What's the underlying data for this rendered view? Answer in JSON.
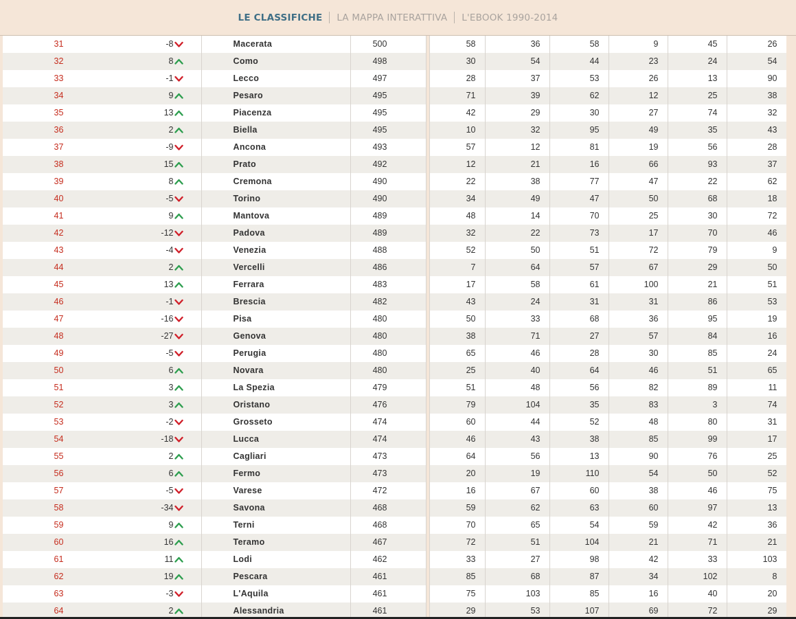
{
  "nav": {
    "items": [
      {
        "label": "LE CLASSIFICHE",
        "active": true
      },
      {
        "label": "LA MAPPA INTERATTIVA",
        "active": false
      },
      {
        "label": "L'EBOOK 1990-2014",
        "active": false
      }
    ]
  },
  "colors": {
    "background": "#f5e6d8",
    "active_nav": "#3f6f86",
    "position_red": "#c52c1d",
    "arrow_up": "#2e9e4f",
    "arrow_down": "#d0202a",
    "row_alt": "#efede8"
  },
  "table": {
    "rows": [
      {
        "pos": "31",
        "var": "-8",
        "dir": "down",
        "city": "Macerata",
        "score": "500",
        "c1": "58",
        "c2": "36",
        "c3": "58",
        "c4": "9",
        "c5": "45",
        "c6": "26"
      },
      {
        "pos": "32",
        "var": "8",
        "dir": "up",
        "city": "Como",
        "score": "498",
        "c1": "30",
        "c2": "54",
        "c3": "44",
        "c4": "23",
        "c5": "24",
        "c6": "54"
      },
      {
        "pos": "33",
        "var": "-1",
        "dir": "down",
        "city": "Lecco",
        "score": "497",
        "c1": "28",
        "c2": "37",
        "c3": "53",
        "c4": "26",
        "c5": "13",
        "c6": "90"
      },
      {
        "pos": "34",
        "var": "9",
        "dir": "up",
        "city": "Pesaro",
        "score": "495",
        "c1": "71",
        "c2": "39",
        "c3": "62",
        "c4": "12",
        "c5": "25",
        "c6": "38"
      },
      {
        "pos": "35",
        "var": "13",
        "dir": "up",
        "city": "Piacenza",
        "score": "495",
        "c1": "42",
        "c2": "29",
        "c3": "30",
        "c4": "27",
        "c5": "74",
        "c6": "32"
      },
      {
        "pos": "36",
        "var": "2",
        "dir": "up",
        "city": "Biella",
        "score": "495",
        "c1": "10",
        "c2": "32",
        "c3": "95",
        "c4": "49",
        "c5": "35",
        "c6": "43"
      },
      {
        "pos": "37",
        "var": "-9",
        "dir": "down",
        "city": "Ancona",
        "score": "493",
        "c1": "57",
        "c2": "12",
        "c3": "81",
        "c4": "19",
        "c5": "56",
        "c6": "28"
      },
      {
        "pos": "38",
        "var": "15",
        "dir": "up",
        "city": "Prato",
        "score": "492",
        "c1": "12",
        "c2": "21",
        "c3": "16",
        "c4": "66",
        "c5": "93",
        "c6": "37"
      },
      {
        "pos": "39",
        "var": "8",
        "dir": "up",
        "city": "Cremona",
        "score": "490",
        "c1": "22",
        "c2": "38",
        "c3": "77",
        "c4": "47",
        "c5": "22",
        "c6": "62"
      },
      {
        "pos": "40",
        "var": "-5",
        "dir": "down",
        "city": "Torino",
        "score": "490",
        "c1": "34",
        "c2": "49",
        "c3": "47",
        "c4": "50",
        "c5": "68",
        "c6": "18"
      },
      {
        "pos": "41",
        "var": "9",
        "dir": "up",
        "city": "Mantova",
        "score": "489",
        "c1": "48",
        "c2": "14",
        "c3": "70",
        "c4": "25",
        "c5": "30",
        "c6": "72"
      },
      {
        "pos": "42",
        "var": "-12",
        "dir": "down",
        "city": "Padova",
        "score": "489",
        "c1": "32",
        "c2": "22",
        "c3": "73",
        "c4": "17",
        "c5": "70",
        "c6": "46"
      },
      {
        "pos": "43",
        "var": "-4",
        "dir": "down",
        "city": "Venezia",
        "score": "488",
        "c1": "52",
        "c2": "50",
        "c3": "51",
        "c4": "72",
        "c5": "79",
        "c6": "9"
      },
      {
        "pos": "44",
        "var": "2",
        "dir": "up",
        "city": "Vercelli",
        "score": "486",
        "c1": "7",
        "c2": "64",
        "c3": "57",
        "c4": "67",
        "c5": "29",
        "c6": "50"
      },
      {
        "pos": "45",
        "var": "13",
        "dir": "up",
        "city": "Ferrara",
        "score": "483",
        "c1": "17",
        "c2": "58",
        "c3": "61",
        "c4": "100",
        "c5": "21",
        "c6": "51"
      },
      {
        "pos": "46",
        "var": "-1",
        "dir": "down",
        "city": "Brescia",
        "score": "482",
        "c1": "43",
        "c2": "24",
        "c3": "31",
        "c4": "31",
        "c5": "86",
        "c6": "53"
      },
      {
        "pos": "47",
        "var": "-16",
        "dir": "down",
        "city": "Pisa",
        "score": "480",
        "c1": "50",
        "c2": "33",
        "c3": "68",
        "c4": "36",
        "c5": "95",
        "c6": "19"
      },
      {
        "pos": "48",
        "var": "-27",
        "dir": "down",
        "city": "Genova",
        "score": "480",
        "c1": "38",
        "c2": "71",
        "c3": "27",
        "c4": "57",
        "c5": "84",
        "c6": "16"
      },
      {
        "pos": "49",
        "var": "-5",
        "dir": "down",
        "city": "Perugia",
        "score": "480",
        "c1": "65",
        "c2": "46",
        "c3": "28",
        "c4": "30",
        "c5": "85",
        "c6": "24"
      },
      {
        "pos": "50",
        "var": "6",
        "dir": "up",
        "city": "Novara",
        "score": "480",
        "c1": "25",
        "c2": "40",
        "c3": "64",
        "c4": "46",
        "c5": "51",
        "c6": "65"
      },
      {
        "pos": "51",
        "var": "3",
        "dir": "up",
        "city": "La Spezia",
        "score": "479",
        "c1": "51",
        "c2": "48",
        "c3": "56",
        "c4": "82",
        "c5": "89",
        "c6": "11"
      },
      {
        "pos": "52",
        "var": "3",
        "dir": "up",
        "city": "Oristano",
        "score": "476",
        "c1": "79",
        "c2": "104",
        "c3": "35",
        "c4": "83",
        "c5": "3",
        "c6": "74"
      },
      {
        "pos": "53",
        "var": "-2",
        "dir": "down",
        "city": "Grosseto",
        "score": "474",
        "c1": "60",
        "c2": "44",
        "c3": "52",
        "c4": "48",
        "c5": "80",
        "c6": "31"
      },
      {
        "pos": "54",
        "var": "-18",
        "dir": "down",
        "city": "Lucca",
        "score": "474",
        "c1": "46",
        "c2": "43",
        "c3": "38",
        "c4": "85",
        "c5": "99",
        "c6": "17"
      },
      {
        "pos": "55",
        "var": "2",
        "dir": "up",
        "city": "Cagliari",
        "score": "473",
        "c1": "64",
        "c2": "56",
        "c3": "13",
        "c4": "90",
        "c5": "76",
        "c6": "25"
      },
      {
        "pos": "56",
        "var": "6",
        "dir": "up",
        "city": "Fermo",
        "score": "473",
        "c1": "20",
        "c2": "19",
        "c3": "110",
        "c4": "54",
        "c5": "50",
        "c6": "52"
      },
      {
        "pos": "57",
        "var": "-5",
        "dir": "down",
        "city": "Varese",
        "score": "472",
        "c1": "16",
        "c2": "67",
        "c3": "60",
        "c4": "38",
        "c5": "46",
        "c6": "75"
      },
      {
        "pos": "58",
        "var": "-34",
        "dir": "down",
        "city": "Savona",
        "score": "468",
        "c1": "59",
        "c2": "62",
        "c3": "63",
        "c4": "60",
        "c5": "97",
        "c6": "13"
      },
      {
        "pos": "59",
        "var": "9",
        "dir": "up",
        "city": "Terni",
        "score": "468",
        "c1": "70",
        "c2": "65",
        "c3": "54",
        "c4": "59",
        "c5": "42",
        "c6": "36"
      },
      {
        "pos": "60",
        "var": "16",
        "dir": "up",
        "city": "Teramo",
        "score": "467",
        "c1": "72",
        "c2": "51",
        "c3": "104",
        "c4": "21",
        "c5": "71",
        "c6": "21"
      },
      {
        "pos": "61",
        "var": "11",
        "dir": "up",
        "city": "Lodi",
        "score": "462",
        "c1": "33",
        "c2": "27",
        "c3": "98",
        "c4": "42",
        "c5": "33",
        "c6": "103"
      },
      {
        "pos": "62",
        "var": "19",
        "dir": "up",
        "city": "Pescara",
        "score": "461",
        "c1": "85",
        "c2": "68",
        "c3": "87",
        "c4": "34",
        "c5": "102",
        "c6": "8"
      },
      {
        "pos": "63",
        "var": "-3",
        "dir": "down",
        "city": "L'Aquila",
        "score": "461",
        "c1": "75",
        "c2": "103",
        "c3": "85",
        "c4": "16",
        "c5": "40",
        "c6": "20"
      },
      {
        "pos": "64",
        "var": "2",
        "dir": "up",
        "city": "Alessandria",
        "score": "461",
        "c1": "29",
        "c2": "53",
        "c3": "107",
        "c4": "69",
        "c5": "72",
        "c6": "29"
      }
    ]
  }
}
